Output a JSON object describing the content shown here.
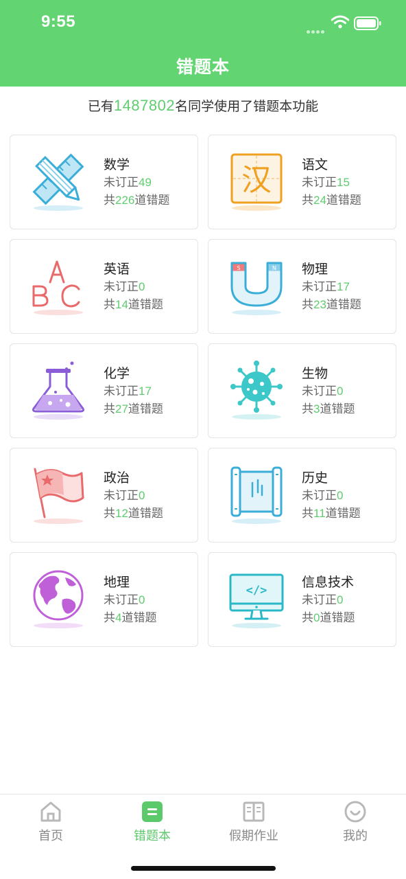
{
  "status": {
    "time": "9:55"
  },
  "nav": {
    "title": "错题本"
  },
  "banner": {
    "prefix": "已有",
    "count": "1487802",
    "suffix": "名同学使用了错题本功能"
  },
  "labels": {
    "unfixed": "未订正",
    "total_prefix": "共",
    "total_suffix": "道错题"
  },
  "subjects": [
    {
      "name": "数学",
      "unfixed": "49",
      "total": "226",
      "icon": "ruler-pencil-icon",
      "color": "#3aaed8"
    },
    {
      "name": "语文",
      "unfixed": "15",
      "total": "24",
      "icon": "chinese-character-icon",
      "color": "#f0a020"
    },
    {
      "name": "英语",
      "unfixed": "0",
      "total": "14",
      "icon": "abc-letters-icon",
      "color": "#e86a6a"
    },
    {
      "name": "物理",
      "unfixed": "17",
      "total": "23",
      "icon": "magnet-icon",
      "color": "#3aaed8"
    },
    {
      "name": "化学",
      "unfixed": "17",
      "total": "27",
      "icon": "flask-icon",
      "color": "#8a5cd8"
    },
    {
      "name": "生物",
      "unfixed": "0",
      "total": "3",
      "icon": "virus-icon",
      "color": "#3cc8c8"
    },
    {
      "name": "政治",
      "unfixed": "0",
      "total": "12",
      "icon": "flag-icon",
      "color": "#e86a6a"
    },
    {
      "name": "历史",
      "unfixed": "0",
      "total": "11",
      "icon": "scroll-icon",
      "color": "#3aaed8"
    },
    {
      "name": "地理",
      "unfixed": "0",
      "total": "4",
      "icon": "globe-icon",
      "color": "#c060d8"
    },
    {
      "name": "信息技术",
      "unfixed": "0",
      "total": "0",
      "icon": "computer-code-icon",
      "color": "#2ab8c8"
    }
  ],
  "tabs": [
    {
      "label": "首页",
      "icon": "home-icon",
      "active": false
    },
    {
      "label": "错题本",
      "icon": "notebook-icon",
      "active": true
    },
    {
      "label": "假期作业",
      "icon": "book-icon",
      "active": false
    },
    {
      "label": "我的",
      "icon": "smile-icon",
      "active": false
    }
  ],
  "colors": {
    "brand": "#62d472",
    "accent_number": "#5fcc6e",
    "tab_inactive": "#8a8a8a"
  }
}
